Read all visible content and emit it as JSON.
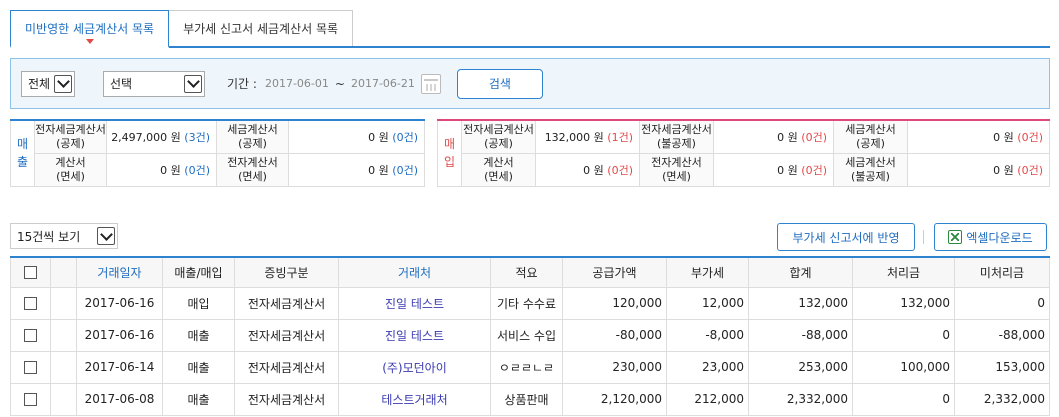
{
  "tabs": [
    {
      "label": "미반영한 세금계산서 목록",
      "active": true
    },
    {
      "label": "부가세 신고서 세금계산서 목록",
      "active": false
    }
  ],
  "filter": {
    "scope": "전체",
    "select": "선택",
    "period_label": "기간 :",
    "start_date": "2017-06-01",
    "tilde": "~",
    "end_date": "2017-06-21",
    "search_label": "검색"
  },
  "sales_summary": {
    "side_label": "매 출",
    "cells": [
      {
        "label1": "전자세금계산서",
        "label2": "(공제)",
        "amount": "2,497,000 원",
        "count": "(3건)"
      },
      {
        "label1": "세금계산서",
        "label2": "(공제)",
        "amount": "0 원",
        "count": "(0건)"
      },
      {
        "label1": "계산서",
        "label2": "(면세)",
        "amount": "0 원",
        "count": "(0건)"
      },
      {
        "label1": "전자계산서",
        "label2": "(면세)",
        "amount": "0 원",
        "count": "(0건)"
      }
    ]
  },
  "purchase_summary": {
    "side_label": "매 입",
    "cells": [
      {
        "label1": "전자세금계산서",
        "label2": "(공제)",
        "amount": "132,000 원",
        "count": "(1건)"
      },
      {
        "label1": "전자세금계산서",
        "label2": "(불공제)",
        "amount": "0 원",
        "count": "(0건)"
      },
      {
        "label1": "세금계산서",
        "label2": "(공제)",
        "amount": "0 원",
        "count": "(0건)"
      },
      {
        "label1": "계산서",
        "label2": "(면세)",
        "amount": "0 원",
        "count": "(0건)"
      },
      {
        "label1": "전자계산서",
        "label2": "(면세)",
        "amount": "0 원",
        "count": "(0건)"
      },
      {
        "label1": "세금계산서",
        "label2": "(불공제)",
        "amount": "0 원",
        "count": "(0건)"
      }
    ]
  },
  "toolbar": {
    "page_size": "15건씩 보기",
    "reflect_label": "부가세 신고서에 반영",
    "excel_label": "엑셀다운로드"
  },
  "table": {
    "headers": [
      "",
      "거래일자",
      "매출/매입",
      "증빙구분",
      "거래처",
      "적요",
      "공급가액",
      "부가세",
      "합계",
      "처리금",
      "미처리금"
    ],
    "rows": [
      {
        "date": "2017-06-16",
        "type": "매입",
        "doc": "전자세금계산서",
        "partner": "진일 테스트",
        "memo": "기타 수수료",
        "supply": "120,000",
        "vat": "12,000",
        "total": "132,000",
        "processed": "132,000",
        "unprocessed": "0"
      },
      {
        "date": "2017-06-16",
        "type": "매출",
        "doc": "전자세금계산서",
        "partner": "진일 테스트",
        "memo": "서비스 수입",
        "supply": "-80,000",
        "vat": "-8,000",
        "total": "-88,000",
        "processed": "0",
        "unprocessed": "-88,000"
      },
      {
        "date": "2017-06-14",
        "type": "매출",
        "doc": "전자세금계산서",
        "partner": "(주)모던아이",
        "memo": "ㅇㄹㄹㄴㄹ",
        "supply": "230,000",
        "vat": "23,000",
        "total": "253,000",
        "processed": "100,000",
        "unprocessed": "153,000"
      },
      {
        "date": "2017-06-08",
        "type": "매출",
        "doc": "전자세금계산서",
        "partner": "테스트거래처",
        "memo": "상품판매",
        "supply": "2,120,000",
        "vat": "212,000",
        "total": "2,332,000",
        "processed": "0",
        "unprocessed": "2,332,000"
      }
    ]
  },
  "colors": {
    "accent": "#2f82cf",
    "purchase": "#e04a4a",
    "sales": "#1f6dc0"
  }
}
